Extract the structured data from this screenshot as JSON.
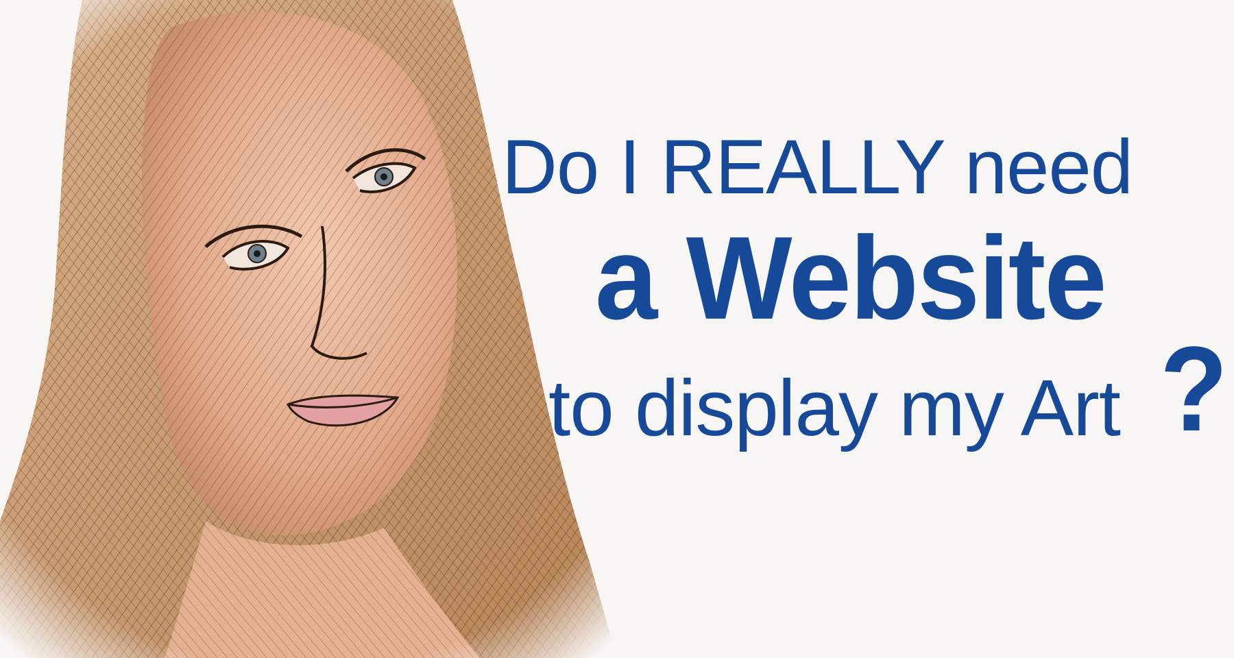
{
  "headline": {
    "line1": "Do I REALLY need",
    "line2": "a Website",
    "line3": "to display my Art",
    "question_mark": "?"
  },
  "colors": {
    "text": "#164a98",
    "background": "#f7f6f4",
    "skin": "#e9b79a",
    "hair": "#c99a6a",
    "ink": "#2a1a10"
  },
  "portrait": {
    "icon": "crosshatched-woman-portrait"
  }
}
